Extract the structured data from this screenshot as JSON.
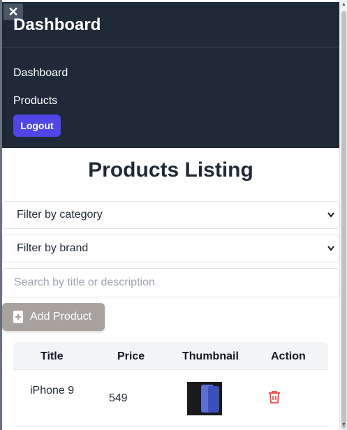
{
  "sidebar": {
    "close_label": "✕",
    "title": "Dashboard",
    "links": [
      "Dashboard",
      "Products"
    ],
    "logout_label": "Logout"
  },
  "main": {
    "title": "Products Listing",
    "category_filter": "Filter by category",
    "brand_filter": "Filter by brand",
    "search_placeholder": "Search by title or description",
    "add_button": "Add Product"
  },
  "table": {
    "headers": [
      "Title",
      "Price",
      "Thumbnail",
      "Action"
    ],
    "rows": [
      {
        "title": "iPhone 9",
        "price": "549",
        "thumbnail": "phone-image",
        "action": "trash-icon"
      }
    ]
  },
  "colors": {
    "sidebar_bg": "#1f2937",
    "accent": "#4f46e5",
    "add_button_bg": "#a8a29e",
    "delete": "#ef4444"
  }
}
